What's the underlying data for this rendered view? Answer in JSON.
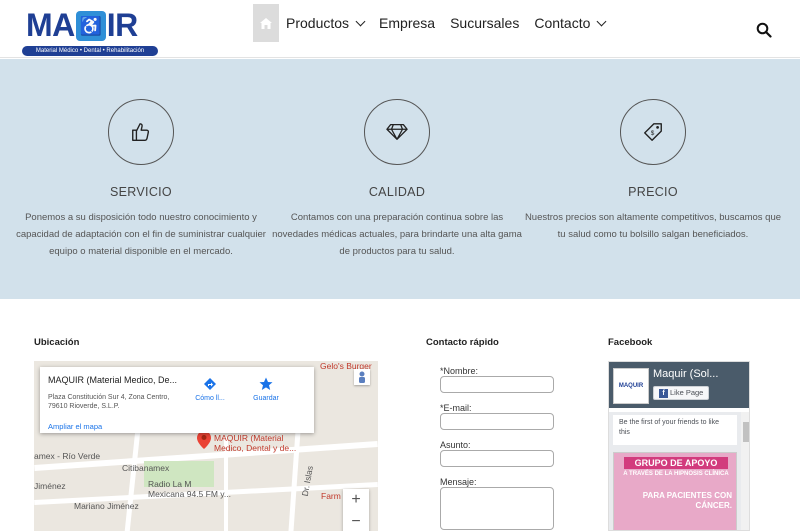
{
  "brand": {
    "logo_word_left": "MA",
    "logo_word_u": "U",
    "logo_word_right": "IR",
    "tagline": "Material Médico • Dental • Rehabilitación",
    "primary_color": "#1f3f94",
    "accent_color": "#2f8fd7"
  },
  "nav": {
    "home_icon": "home-icon",
    "items": [
      {
        "label": "Productos",
        "has_dropdown": true
      },
      {
        "label": "Empresa",
        "has_dropdown": false
      },
      {
        "label": "Sucursales",
        "has_dropdown": false
      },
      {
        "label": "Contacto",
        "has_dropdown": true
      }
    ],
    "search_icon": "search-icon"
  },
  "features": [
    {
      "icon": "thumbs-up-icon",
      "title": "SERVICIO",
      "description": "Ponemos a su disposición todo nuestro conocimiento y capacidad de adaptación con el fin de suministrar cualquier equipo o material disponible en el mercado."
    },
    {
      "icon": "diamond-icon",
      "title": "CALIDAD",
      "description": "Contamos con una preparación continua sobre las novedades médicas actuales, para brindarte una alta gama de productos para tu salud."
    },
    {
      "icon": "price-tag-icon",
      "title": "PRECIO",
      "description": "Nuestros precios son altamente competitivos, buscamos que tu salud como tu bolsillo salgan beneficiados."
    }
  ],
  "location": {
    "heading": "Ubicación",
    "place_name": "MAQUIR (Material Medico, De...",
    "address": "Plaza Constitución Sur 4, Zona Centro, 79610 Rioverde, S.L.P.",
    "enlarge_link": "Ampliar el mapa",
    "directions_label": "Cómo ll...",
    "save_label": "Guardar",
    "marker_label": "MAQUIR (Material Medico, Dental y de...",
    "map_labels": [
      "Citibanamex",
      "amex - Río Verde",
      "Jiménez",
      "Radio La M",
      "Mexicana 94.5 FM y...",
      "Mariano Jiménez",
      "Dr. Islas",
      "Farm",
      "Gelo's Burger"
    ],
    "zoom_in": "+",
    "zoom_out": "−"
  },
  "contact": {
    "heading": "Contacto rápido",
    "fields": [
      {
        "label": "*Nombre:",
        "value": ""
      },
      {
        "label": "*E-mail:",
        "value": ""
      },
      {
        "label": "Asunto:",
        "value": ""
      },
      {
        "label": "Mensaje:",
        "value": ""
      }
    ]
  },
  "facebook": {
    "heading": "Facebook",
    "page_name": "Maquir (Sol...",
    "like_button": "Like Page",
    "first_friend_text": "Be the first of your friends to like this",
    "post_banner": "GRUPO DE APOYO",
    "post_sub": "A TRAVÉS DE LA HIPNOSIS CLÍNICA",
    "post_text": "PARA PACIENTES CON CÁNCER."
  }
}
